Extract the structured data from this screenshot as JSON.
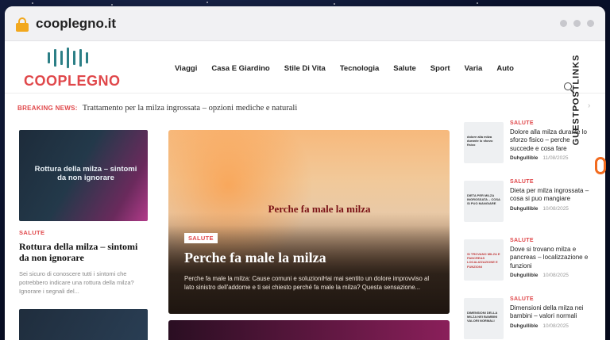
{
  "browser": {
    "url": "cooplegno.it"
  },
  "site": {
    "logo_text": "COOPLEGNO",
    "nav": [
      "Viaggi",
      "Casa E Giardino",
      "Stile Di Vita",
      "Tecnologia",
      "Salute",
      "Sport",
      "Varia",
      "Auto"
    ]
  },
  "breaking": {
    "label": "BREAKING NEWS:",
    "title": "Trattamento per la milza ingrossata – opzioni mediche e naturali"
  },
  "left_card": {
    "thumb_text": "Rottura della milza – sintomi da non ignorare",
    "category": "SALUTE",
    "title": "Rottura della milza – sintomi da non ignorare",
    "excerpt": "Sei sicuro di conoscere tutti i sintomi che potrebbero indicare una rottura della milza? Ignorare i segnali del..."
  },
  "hero": {
    "image_title": "Perche fa male la milza",
    "category": "SALUTE",
    "title": "Perche fa male la milza",
    "excerpt": "Perche fa male la milza: Cause comuni e soluzioniHai mai sentito un dolore improvviso al lato sinistro dell'addome e ti sei chiesto perché fa male la milza? Questa sensazione..."
  },
  "side_articles": [
    {
      "thumb_text": "dolore alla milza durante lo sforzo fisico",
      "category": "SALUTE",
      "title": "Dolore alla milza durante lo sforzo fisico – perche succede e cosa fare",
      "author": "Duhgullible",
      "date": "11/08/2025"
    },
    {
      "thumb_text": "DIETA PER MILZA INGROSSATA – COSA SI PUO MANGIARE",
      "category": "SALUTE",
      "title": "Dieta per milza ingrossata – cosa si puo mangiare",
      "author": "Duhgullible",
      "date": "10/08/2025"
    },
    {
      "thumb_text": "SI TROVANO MILZA E PANCREAS LOCALIZZAZIONE E FUNZIONI",
      "category": "SALUTE",
      "title": "Dove si trovano milza e pancreas – localizzazione e funzioni",
      "author": "Duhgullible",
      "date": "10/08/2025"
    },
    {
      "thumb_text": "DIMENSIONI DELLA MILZA NEI BAMBINI VALORI NORMALI",
      "category": "SALUTE",
      "title": "Dimensioni della milza nei bambini – valori normali",
      "author": "Duhgullible",
      "date": "10/08/2025"
    }
  ],
  "brand_watermark": "GUESTPOSTLINKS"
}
